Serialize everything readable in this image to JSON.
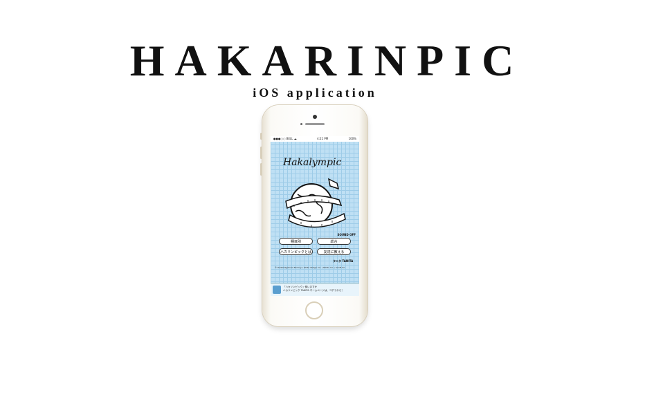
{
  "header": {
    "title": "HAKARINPIC",
    "subtitle": "iOS application"
  },
  "phone": {
    "status_bar": {
      "carrier": "●●●○○ BELL ☁",
      "time": "4:21 PM",
      "battery": "100%"
    },
    "app_logo": "Hakalympic",
    "sound_toggle": "SOUND OFF",
    "buttons": {
      "by_event": "種目別",
      "overall": "総合",
      "about": "ハカリンピックとは",
      "tell_friends": "友達に教える"
    },
    "credits": "© Rodemagebura Factory / white design inc. / Tahito Inc. / enoff Inc.",
    "brand_mark": "タニタ TANITA",
    "ad": {
      "line1": "「ハカリンピック」使いますか",
      "line2": "ハカリンピック TANITA ホームページは、コチラから！"
    }
  },
  "colors": {
    "screen_bg": "#bfe0f4",
    "grid": "#9ecce8",
    "phone_body": "#fbfaf6",
    "phone_trim": "#d8cfbb"
  }
}
